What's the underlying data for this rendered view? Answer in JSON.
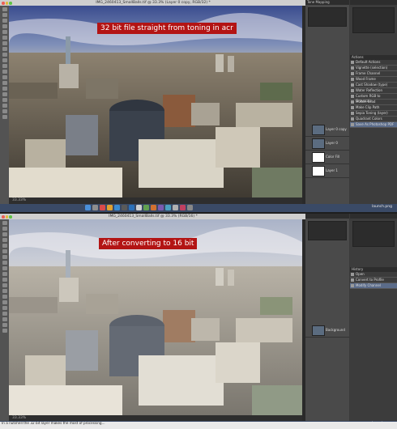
{
  "top": {
    "window_title": "IMG_2460413_SmallBalls.tif @ 33.3% (Layer 0 copy, RGB/32) *",
    "banner": "32 bit file straight from toning in acr",
    "status": "33.33%",
    "histogram_label": "Tone Mapping",
    "actions_panel_title": "Actions",
    "actions": [
      "Default Actions",
      "Vignette (selection)",
      "Frame Channel",
      "Wood Frame",
      "Cast Shadow (type)",
      "Water Reflection",
      "Custom RGB to Grayscale",
      "Molten Lead",
      "Make Clip Path",
      "Sepia Toning (layer)",
      "Quadrant Colors",
      "Save As Photoshop PDF"
    ],
    "layers": [
      {
        "name": "Layer 0 copy",
        "thumb": "img"
      },
      {
        "name": "Layer 0",
        "thumb": "img"
      },
      {
        "name": "Color Fill",
        "thumb": "white"
      },
      {
        "name": "Layer 1",
        "thumb": "white"
      }
    ],
    "dock_label": "launch.png"
  },
  "bottom": {
    "window_title": "IMG_2460413_SmallBalls.tif @ 33.3% (RGB/16) *",
    "banner": "After converting to 16 bit",
    "status": "33.33%",
    "history_panel_title": "History",
    "history": [
      "Open",
      "Convert to Profile",
      "Modify Channel"
    ],
    "layers": [
      {
        "name": "Background",
        "thumb": "img"
      }
    ],
    "dock_label": "launch.png"
  },
  "caption": "In a nutshell the 32 bit layer makes the most of processing...",
  "colors": {
    "banner_bg": "#b31414",
    "ui_dark": "#3a3a3a",
    "selection": "#5b6c8a"
  }
}
